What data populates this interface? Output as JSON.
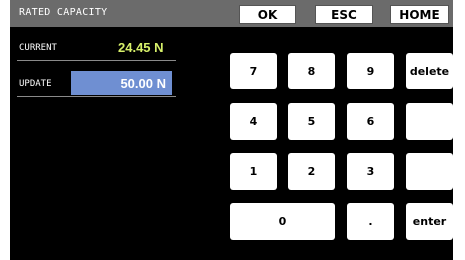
{
  "header": {
    "title": "RATED CAPACITY",
    "ok_label": "OK",
    "esc_label": "ESC",
    "home_label": "HOME"
  },
  "current": {
    "label": "CURRENT",
    "value": "24.45 N"
  },
  "update": {
    "label": "UPDATE",
    "value": "50.00 N"
  },
  "colors": {
    "header_bg": "#6b6b6b",
    "current_value": "#d7f06a",
    "update_box": "#6f8fd2",
    "screen_bg": "#000000"
  },
  "keypad": {
    "k7": "7",
    "k8": "8",
    "k9": "9",
    "delete": "delete",
    "k4": "4",
    "k5": "5",
    "k6": "6",
    "blank1": "",
    "k1": "1",
    "k2": "2",
    "k3": "3",
    "blank2": "",
    "k0": "0",
    "dot": ".",
    "enter": "enter"
  }
}
